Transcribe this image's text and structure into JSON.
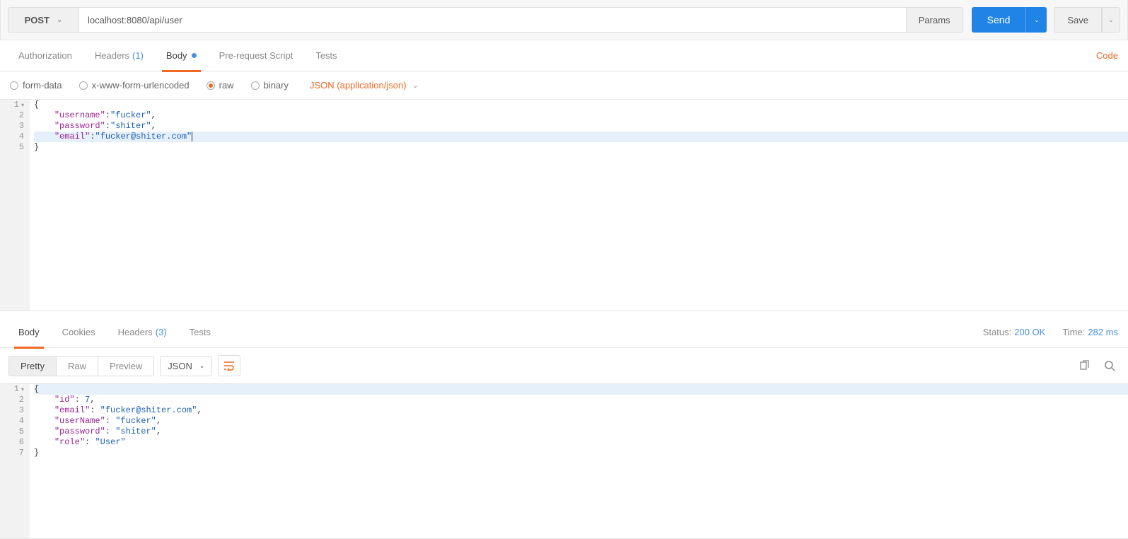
{
  "request": {
    "method": "POST",
    "url": "localhost:8080/api/user",
    "params_label": "Params",
    "send_label": "Send",
    "save_label": "Save"
  },
  "req_tabs": {
    "authorization": "Authorization",
    "headers": "Headers",
    "headers_count": "(1)",
    "body": "Body",
    "prerequest": "Pre-request Script",
    "tests": "Tests",
    "code_link": "Code"
  },
  "body_types": {
    "formdata": "form-data",
    "urlencoded": "x-www-form-urlencoded",
    "raw": "raw",
    "binary": "binary",
    "content_type": "JSON (application/json)"
  },
  "request_body_lines": [
    {
      "n": "1",
      "fold": true,
      "pieces": [
        [
          "brace",
          "{"
        ]
      ]
    },
    {
      "n": "2",
      "pieces": [
        [
          "pad",
          "    "
        ],
        [
          "key",
          "\"username\""
        ],
        [
          "brace",
          ":"
        ],
        [
          "str",
          "\"fucker\""
        ],
        [
          "brace",
          ","
        ]
      ]
    },
    {
      "n": "3",
      "pieces": [
        [
          "pad",
          "    "
        ],
        [
          "key",
          "\"password\""
        ],
        [
          "brace",
          ":"
        ],
        [
          "str",
          "\"shiter\""
        ],
        [
          "brace",
          ","
        ]
      ]
    },
    {
      "n": "4",
      "cur": true,
      "pieces": [
        [
          "pad",
          "    "
        ],
        [
          "key",
          "\"email\""
        ],
        [
          "brace",
          ":"
        ],
        [
          "str",
          "\"fucker@shiter.com\""
        ]
      ],
      "cursor": true
    },
    {
      "n": "5",
      "pieces": [
        [
          "brace",
          "}"
        ]
      ]
    }
  ],
  "resp_tabs": {
    "body": "Body",
    "cookies": "Cookies",
    "headers": "Headers",
    "headers_count": "(3)",
    "tests": "Tests"
  },
  "resp_status": {
    "status_label": "Status:",
    "status_value": "200 OK",
    "time_label": "Time:",
    "time_value": "282 ms"
  },
  "resp_views": {
    "pretty": "Pretty",
    "raw": "Raw",
    "preview": "Preview",
    "lang": "JSON"
  },
  "response_body_lines": [
    {
      "n": "1",
      "fold": true,
      "cur": true,
      "pieces": [
        [
          "brace",
          "{"
        ]
      ]
    },
    {
      "n": "2",
      "pieces": [
        [
          "pad",
          "    "
        ],
        [
          "key",
          "\"id\""
        ],
        [
          "brace",
          ": "
        ],
        [
          "num",
          "7"
        ],
        [
          "brace",
          ","
        ]
      ]
    },
    {
      "n": "3",
      "pieces": [
        [
          "pad",
          "    "
        ],
        [
          "key",
          "\"email\""
        ],
        [
          "brace",
          ": "
        ],
        [
          "str",
          "\"fucker@shiter.com\""
        ],
        [
          "brace",
          ","
        ]
      ]
    },
    {
      "n": "4",
      "pieces": [
        [
          "pad",
          "    "
        ],
        [
          "key",
          "\"userName\""
        ],
        [
          "brace",
          ": "
        ],
        [
          "str",
          "\"fucker\""
        ],
        [
          "brace",
          ","
        ]
      ]
    },
    {
      "n": "5",
      "pieces": [
        [
          "pad",
          "    "
        ],
        [
          "key",
          "\"password\""
        ],
        [
          "brace",
          ": "
        ],
        [
          "str",
          "\"shiter\""
        ],
        [
          "brace",
          ","
        ]
      ]
    },
    {
      "n": "6",
      "pieces": [
        [
          "pad",
          "    "
        ],
        [
          "key",
          "\"role\""
        ],
        [
          "brace",
          ": "
        ],
        [
          "str",
          "\"User\""
        ]
      ]
    },
    {
      "n": "7",
      "pieces": [
        [
          "brace",
          "}"
        ]
      ]
    }
  ]
}
